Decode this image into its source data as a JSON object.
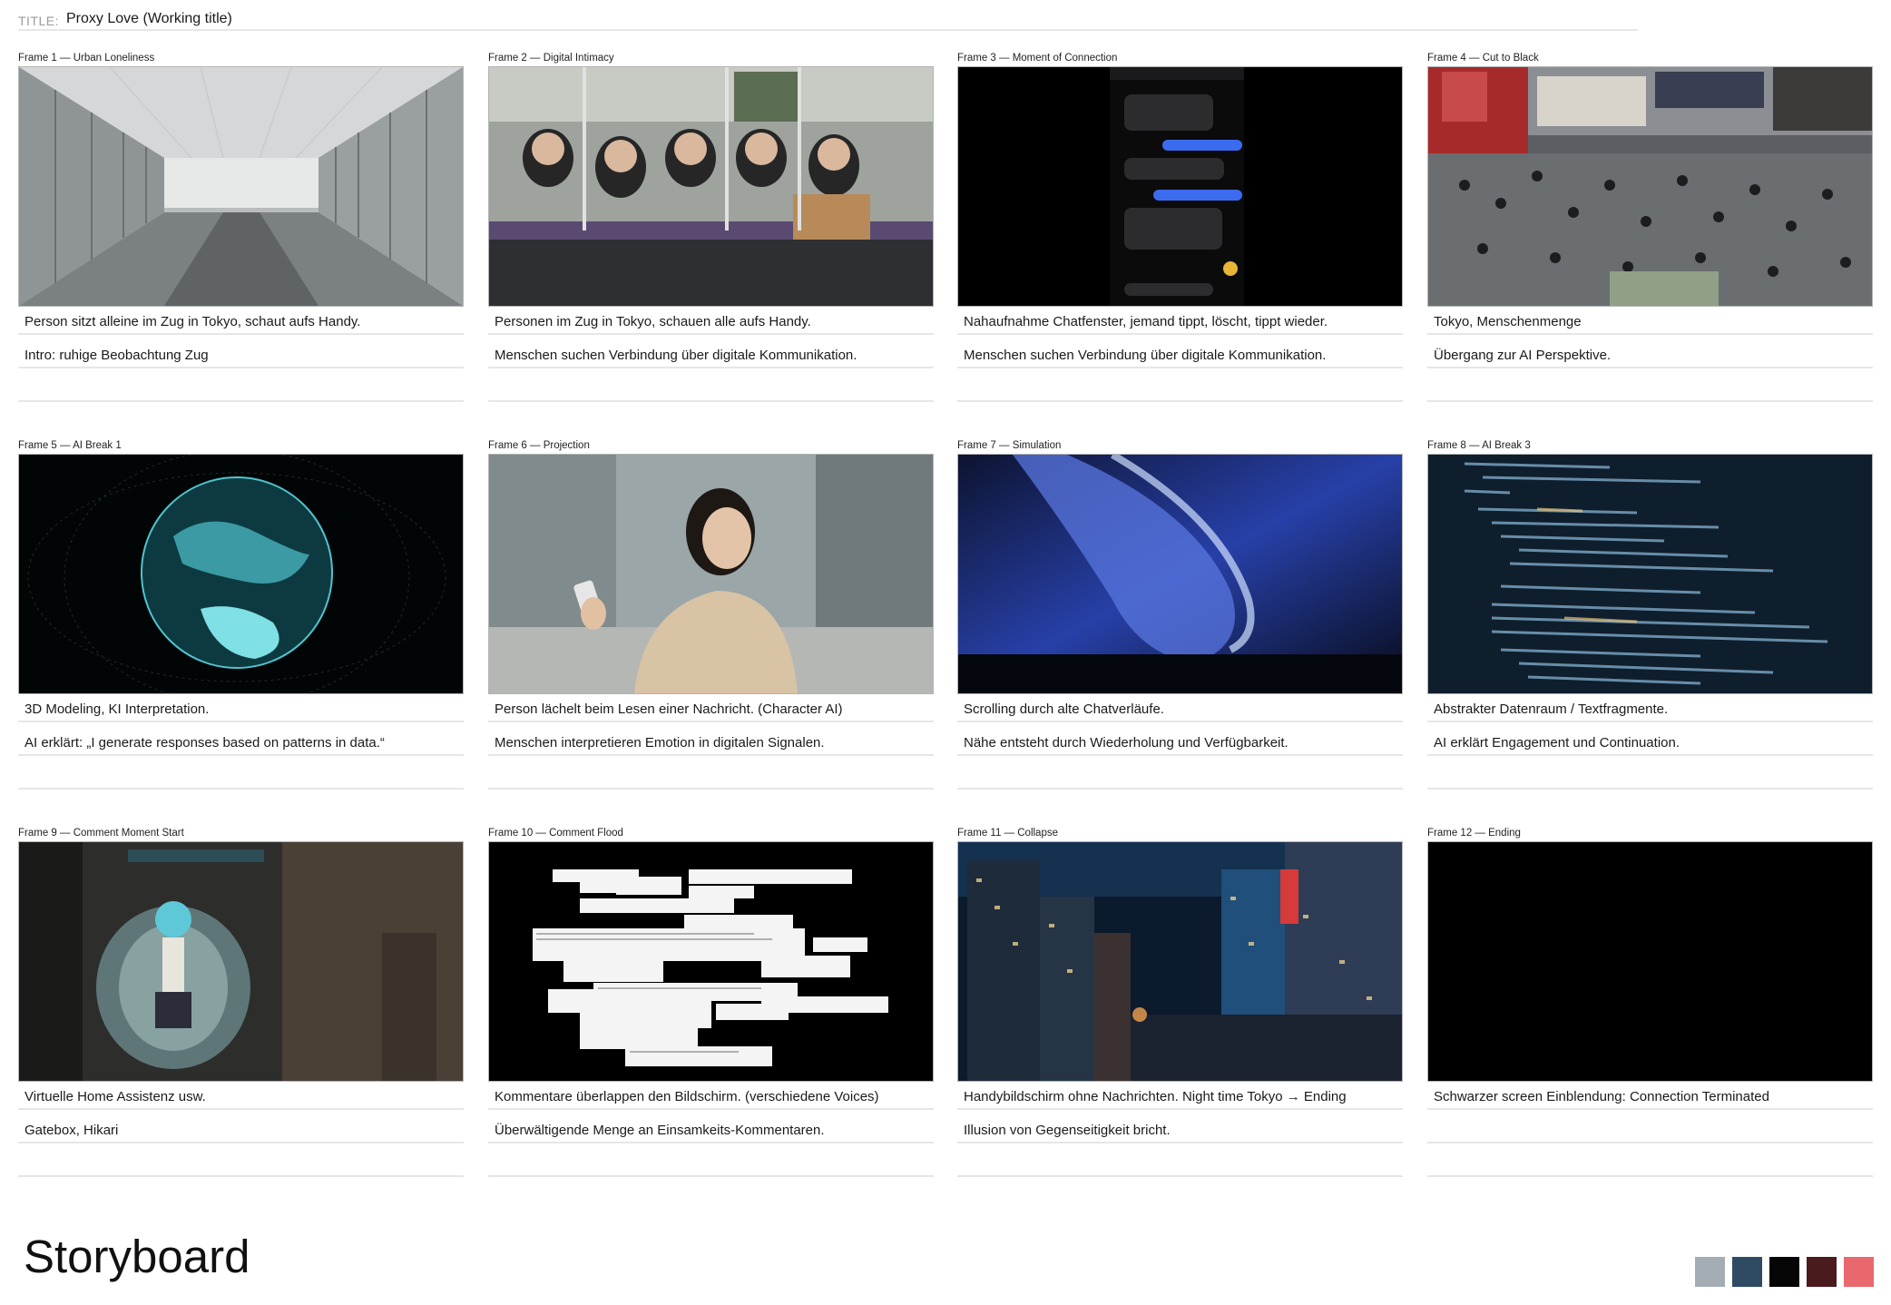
{
  "title": {
    "label": "TITLE:",
    "value": "Proxy Love (Working title)"
  },
  "frames": [
    {
      "label": "Frame 1 — Urban Loneliness",
      "line1": "Person sitzt alleine im Zug in Tokyo, schaut aufs Handy.",
      "line2": "Intro: ruhige Beobachtung Zug",
      "line3": ""
    },
    {
      "label": "Frame 2 — Digital Intimacy",
      "line1": "Personen im Zug in Tokyo, schauen alle aufs Handy.",
      "line2": "Menschen suchen Verbindung über digitale Kommunikation.",
      "line3": ""
    },
    {
      "label": "Frame 3 — Moment of Connection",
      "line1": "Nahaufnahme Chatfenster, jemand tippt, löscht, tippt wieder.",
      "line2": "Menschen suchen Verbindung über digitale Kommunikation.",
      "line3": ""
    },
    {
      "label": "Frame 4 — Cut to Black",
      "line1": "Tokyo, Menschenmenge",
      "line2": "Übergang zur AI Perspektive.",
      "line3": ""
    },
    {
      "label": "Frame 5 — AI Break 1",
      "line1": "3D Modeling, KI Interpretation.",
      "line2": "AI erklärt: „I generate responses based on patterns in data.“",
      "line3": ""
    },
    {
      "label": "Frame 6 — Projection",
      "line1": "Person lächelt beim Lesen einer Nachricht. (Character AI)",
      "line2": "Menschen interpretieren Emotion in digitalen Signalen.",
      "line3": ""
    },
    {
      "label": "Frame 7 — Simulation",
      "line1": "Scrolling durch alte Chatverläufe.",
      "line2": "Nähe entsteht durch Wiederholung und Verfügbarkeit.",
      "line3": ""
    },
    {
      "label": "Frame 8 — AI Break 3",
      "line1": "Abstrakter Datenraum / Textfragmente.",
      "line2": "AI erklärt Engagement und Continuation.",
      "line3": ""
    },
    {
      "label": "Frame 9 — Comment Moment Start",
      "line1": "Virtuelle Home Assistenz usw.",
      "line2": "Gatebox, Hikari",
      "line3": ""
    },
    {
      "label": "Frame 10 — Comment Flood",
      "line1": "Kommentare überlappen den Bildschirm. (verschiedene Voices)",
      "line2": "Überwältigende Menge an Einsamkeits-Kommentaren.",
      "line3": ""
    },
    {
      "label": "Frame 11 — Collapse",
      "line1": "Handybildschirm ohne Nachrichten. Night time Tokyo → Ending",
      "line2": "Illusion von Gegenseitigkeit bricht.",
      "line3": ""
    },
    {
      "label": "Frame 12 — Ending",
      "line1": "Schwarzer screen Einblendung: Connection Terminated",
      "line2": "",
      "line3": ""
    }
  ],
  "thumbnails": [
    "train-walkway-photo",
    "subway-passengers-photo",
    "chat-window-screenshot",
    "crowded-station-photo",
    "digital-globe-render",
    "woman-smiling-phone-photo",
    "finger-touch-screen-photo",
    "code-screen-photo",
    "gatebox-hologram-photo",
    "comment-flood-collage",
    "tokyo-night-city-photo",
    "black-screen"
  ],
  "footer": {
    "heading": "Storyboard"
  },
  "palette": [
    "#a3adb3",
    "#2f4a63",
    "#050505",
    "#4a1a1c",
    "#e8686e"
  ]
}
